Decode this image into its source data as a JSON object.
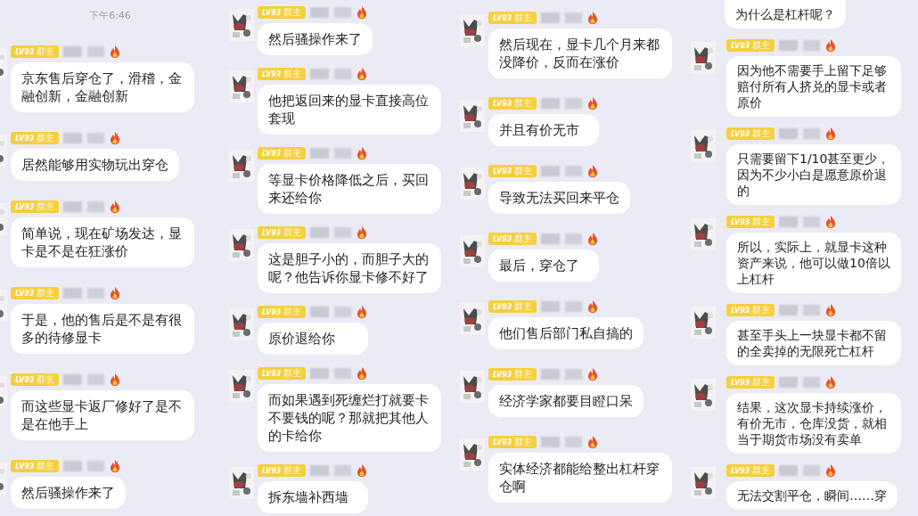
{
  "columns": [
    {
      "items": [
        {
          "kind": "time",
          "text": "下午6:46"
        },
        {
          "kind": "message",
          "level": "LV93",
          "role": "群主",
          "text": "京东售后穿仓了，滑稽，金融创新，金融创新"
        },
        {
          "kind": "message",
          "level": "LV93",
          "role": "群主",
          "text": "居然能够用实物玩出穿仓"
        },
        {
          "kind": "message",
          "level": "LV93",
          "role": "群主",
          "text": "简单说，现在矿场发达，显卡是不是在狂涨价"
        },
        {
          "kind": "message",
          "level": "LV93",
          "role": "群主",
          "text": "于是，他的售后是不是有很多的待修显卡"
        },
        {
          "kind": "message",
          "level": "LV93",
          "role": "群主",
          "text": "而这些显卡返厂修好了是不是在他手上"
        },
        {
          "kind": "message",
          "level": "LV93",
          "role": "群主",
          "text": "然后骚操作来了"
        }
      ]
    },
    {
      "items": [
        {
          "kind": "message",
          "level": "LV93",
          "role": "群主",
          "text": "然后骚操作来了"
        },
        {
          "kind": "message",
          "level": "LV93",
          "role": "群主",
          "text": "他把返回来的显卡直接高位套现"
        },
        {
          "kind": "message",
          "level": "LV93",
          "role": "群主",
          "text": "等显卡价格降低之后，买回来还给你"
        },
        {
          "kind": "message",
          "level": "LV93",
          "role": "群主",
          "text": "这是胆子小的，而胆子大的呢？他告诉你显卡修不好了"
        },
        {
          "kind": "message",
          "level": "LV93",
          "role": "群主",
          "text": "原价退给你"
        },
        {
          "kind": "message",
          "level": "LV93",
          "role": "群主",
          "text": "而如果遇到死缠烂打就要卡不要钱的呢？那就把其他人的卡给你"
        },
        {
          "kind": "message",
          "level": "LV93",
          "role": "群主",
          "text": "拆东墙补西墙"
        }
      ]
    },
    {
      "items": [
        {
          "kind": "message",
          "level": "LV93",
          "role": "群主",
          "text": "然后现在，显卡几个月来都没降价，反而在涨价"
        },
        {
          "kind": "message",
          "level": "LV93",
          "role": "群主",
          "text": "并且有价无市"
        },
        {
          "kind": "message",
          "level": "LV93",
          "role": "群主",
          "text": "导致无法买回来平仓"
        },
        {
          "kind": "message",
          "level": "LV93",
          "role": "群主",
          "text": "最后，穿仓了"
        },
        {
          "kind": "message",
          "level": "LV93",
          "role": "群主",
          "text": "他们售后部门私自搞的"
        },
        {
          "kind": "message",
          "level": "LV93",
          "role": "群主",
          "text": "经济学家都要目瞪口呆"
        },
        {
          "kind": "message",
          "level": "LV93",
          "role": "群主",
          "text": "实体经济都能给整出杠杆穿仓啊"
        }
      ]
    },
    {
      "items": [
        {
          "kind": "continuation",
          "text": "为什么是杠杆呢？"
        },
        {
          "kind": "message",
          "level": "LV93",
          "role": "群主",
          "text": "因为他不需要手上留下足够赔付所有人挤兑的显卡或者原价"
        },
        {
          "kind": "message",
          "level": "LV93",
          "role": "群主",
          "text": "只需要留下1/10甚至更少，因为不少小白是愿意原价退的"
        },
        {
          "kind": "message",
          "level": "LV93",
          "role": "群主",
          "text": "所以，实际上，就显卡这种资产来说，他可以做10倍以上杠杆"
        },
        {
          "kind": "message",
          "level": "LV93",
          "role": "群主",
          "text": "甚至手头上一块显卡都不留的全卖掉的无限死亡杠杆"
        },
        {
          "kind": "message",
          "level": "LV93",
          "role": "群主",
          "text": "结果，这次显卡持续涨价，有价无市，仓库没货，就相当于期货市场没有卖单"
        },
        {
          "kind": "message",
          "level": "LV93",
          "role": "群主",
          "text": "无法交割平仓，瞬间……穿"
        }
      ]
    }
  ]
}
